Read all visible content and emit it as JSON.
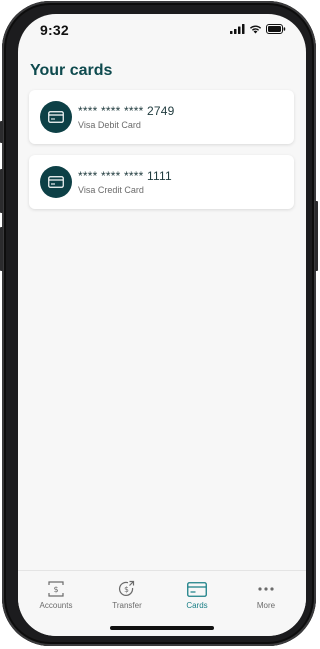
{
  "status_bar": {
    "time": "9:32",
    "icons": [
      "signal-icon",
      "wifi-icon",
      "battery-icon"
    ]
  },
  "page": {
    "title": "Your cards"
  },
  "cards": [
    {
      "number": "**** **** **** 2749",
      "type": "Visa Debit Card",
      "icon": "credit-card-icon"
    },
    {
      "number": "**** **** **** 1111",
      "type": "Visa Credit Card",
      "icon": "credit-card-icon"
    }
  ],
  "tabs": [
    {
      "label": "Accounts",
      "icon": "accounts-icon",
      "active": false
    },
    {
      "label": "Transfer",
      "icon": "transfer-icon",
      "active": false
    },
    {
      "label": "Cards",
      "icon": "cards-icon",
      "active": true
    },
    {
      "label": "More",
      "icon": "more-icon",
      "active": false
    }
  ],
  "colors": {
    "brand_dark": "#0e4a4e",
    "avatar_bg": "#0d4046",
    "accent_active": "#1a7f86",
    "inactive": "#6b6b6b",
    "screen_bg": "#f7f7f7"
  }
}
